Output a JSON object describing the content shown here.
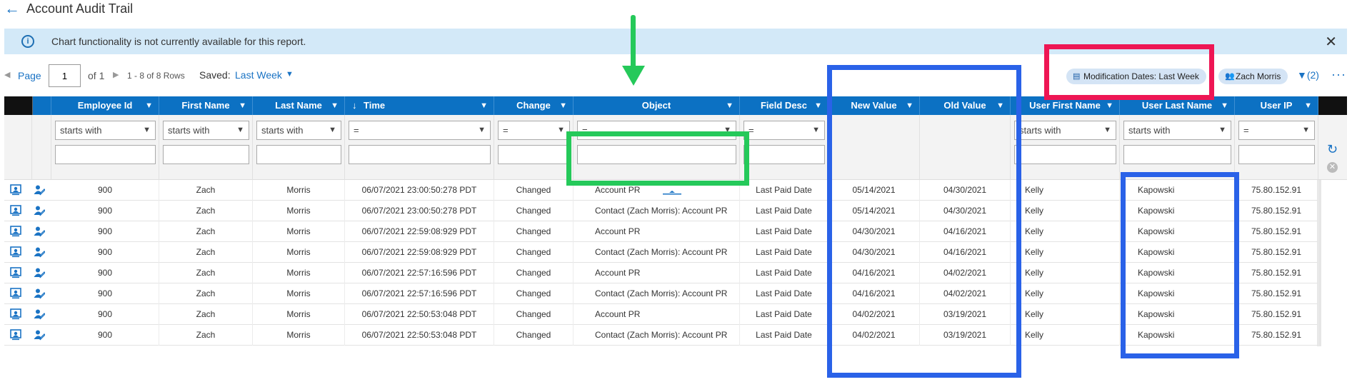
{
  "header": {
    "title": "Account Audit Trail",
    "back_icon": "arrow-left-icon"
  },
  "banner": {
    "message": "Chart functionality is not currently available for this report.",
    "close_symbol": "✕"
  },
  "toolbar": {
    "page_label": "Page",
    "page_value": "1",
    "of_text": "of 1",
    "rows_text": "1 - 8 of 8 Rows",
    "saved_label": "Saved:",
    "saved_value": "Last Week",
    "chips": [
      {
        "label": "Modification Dates: Last Week",
        "icon": "calendar-icon"
      },
      {
        "label": "Zach Morris",
        "icon": "user-group-icon"
      }
    ],
    "filter_count": "(2)",
    "more_symbol": "···"
  },
  "columns": [
    {
      "label": "Employee Id",
      "filter_op": "starts with"
    },
    {
      "label": "First Name",
      "filter_op": "starts with"
    },
    {
      "label": "Last Name",
      "filter_op": "starts with"
    },
    {
      "label": "Time",
      "filter_op": "=",
      "sort": "desc"
    },
    {
      "label": "Change",
      "filter_op": "="
    },
    {
      "label": "Object",
      "filter_op": "="
    },
    {
      "label": "Field Desc",
      "filter_op": "="
    },
    {
      "label": "New Value",
      "filter_op": ""
    },
    {
      "label": "Old Value",
      "filter_op": ""
    },
    {
      "label": "User First Name",
      "filter_op": "starts with"
    },
    {
      "label": "User Last Name",
      "filter_op": "starts with"
    },
    {
      "label": "User IP",
      "filter_op": "="
    }
  ],
  "rows": [
    [
      "900",
      "Zach",
      "Morris",
      "06/07/2021 23:00:50:278 PDT",
      "Changed",
      "Account PR",
      "Last Paid Date",
      "05/14/2021",
      "04/30/2021",
      "Kelly",
      "Kapowski",
      "75.80.152.91"
    ],
    [
      "900",
      "Zach",
      "Morris",
      "06/07/2021 23:00:50:278 PDT",
      "Changed",
      "Contact (Zach Morris): Account PR",
      "Last Paid Date",
      "05/14/2021",
      "04/30/2021",
      "Kelly",
      "Kapowski",
      "75.80.152.91"
    ],
    [
      "900",
      "Zach",
      "Morris",
      "06/07/2021 22:59:08:929 PDT",
      "Changed",
      "Account PR",
      "Last Paid Date",
      "04/30/2021",
      "04/16/2021",
      "Kelly",
      "Kapowski",
      "75.80.152.91"
    ],
    [
      "900",
      "Zach",
      "Morris",
      "06/07/2021 22:59:08:929 PDT",
      "Changed",
      "Contact (Zach Morris): Account PR",
      "Last Paid Date",
      "04/30/2021",
      "04/16/2021",
      "Kelly",
      "Kapowski",
      "75.80.152.91"
    ],
    [
      "900",
      "Zach",
      "Morris",
      "06/07/2021 22:57:16:596 PDT",
      "Changed",
      "Account PR",
      "Last Paid Date",
      "04/16/2021",
      "04/02/2021",
      "Kelly",
      "Kapowski",
      "75.80.152.91"
    ],
    [
      "900",
      "Zach",
      "Morris",
      "06/07/2021 22:57:16:596 PDT",
      "Changed",
      "Contact (Zach Morris): Account PR",
      "Last Paid Date",
      "04/16/2021",
      "04/02/2021",
      "Kelly",
      "Kapowski",
      "75.80.152.91"
    ],
    [
      "900",
      "Zach",
      "Morris",
      "06/07/2021 22:50:53:048 PDT",
      "Changed",
      "Account PR",
      "Last Paid Date",
      "04/02/2021",
      "03/19/2021",
      "Kelly",
      "Kapowski",
      "75.80.152.91"
    ],
    [
      "900",
      "Zach",
      "Morris",
      "06/07/2021 22:50:53:048 PDT",
      "Changed",
      "Contact (Zach Morris): Account PR",
      "Last Paid Date",
      "04/02/2021",
      "03/19/2021",
      "Kelly",
      "Kapowski",
      "75.80.152.91"
    ]
  ],
  "row_icons": [
    "view-record-icon",
    "edit-user-icon"
  ],
  "colors": {
    "header_blue": "#0c71c3",
    "accent": "#1a73c4",
    "banner_bg": "#d3e9f8",
    "annotation_green": "#25c95a",
    "annotation_red": "#ee1654",
    "annotation_blue": "#2a62e8"
  },
  "annotations": [
    {
      "type": "arrow",
      "color": "green",
      "target": "object-filter-input"
    },
    {
      "type": "box",
      "color": "green",
      "target": "object-filter-input"
    },
    {
      "type": "box",
      "color": "red",
      "target": "modification-dates-chip"
    },
    {
      "type": "box",
      "color": "blue",
      "target": "new-old-value-columns"
    },
    {
      "type": "box",
      "color": "blue",
      "target": "user-last-name-column"
    }
  ]
}
